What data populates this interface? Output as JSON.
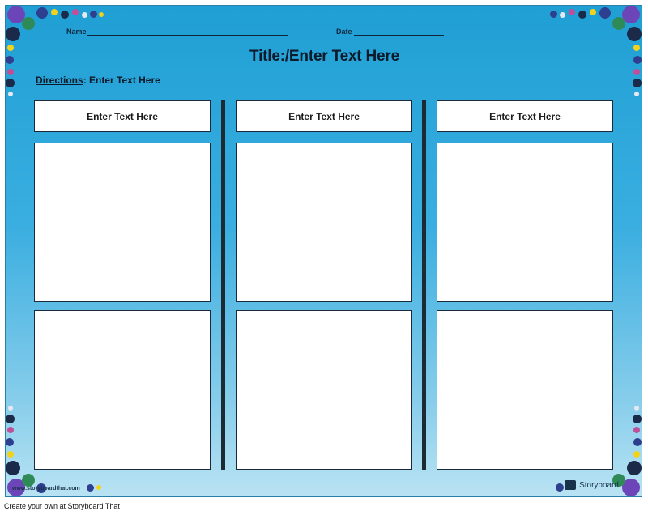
{
  "header": {
    "name_label": "Name",
    "date_label": "Date"
  },
  "title": "Title:/Enter Text Here",
  "directions": {
    "label": "Directions",
    "text": ": Enter Text Here"
  },
  "columns": [
    {
      "heading": "Enter Text Here"
    },
    {
      "heading": "Enter Text Here"
    },
    {
      "heading": "Enter Text Here"
    }
  ],
  "watermark": "www.storyboardthat.com",
  "brand": "Storyboard",
  "caption": "Create your own at Storyboard That",
  "colors": {
    "background_top": "#1f9fd4",
    "background_bottom": "#b9e3f3",
    "divider": "#1c2a33",
    "decor": [
      "#2f3f8f",
      "#6c45b8",
      "#2e8b57",
      "#f2d21b",
      "#c04f9a",
      "#1b2a49"
    ]
  }
}
